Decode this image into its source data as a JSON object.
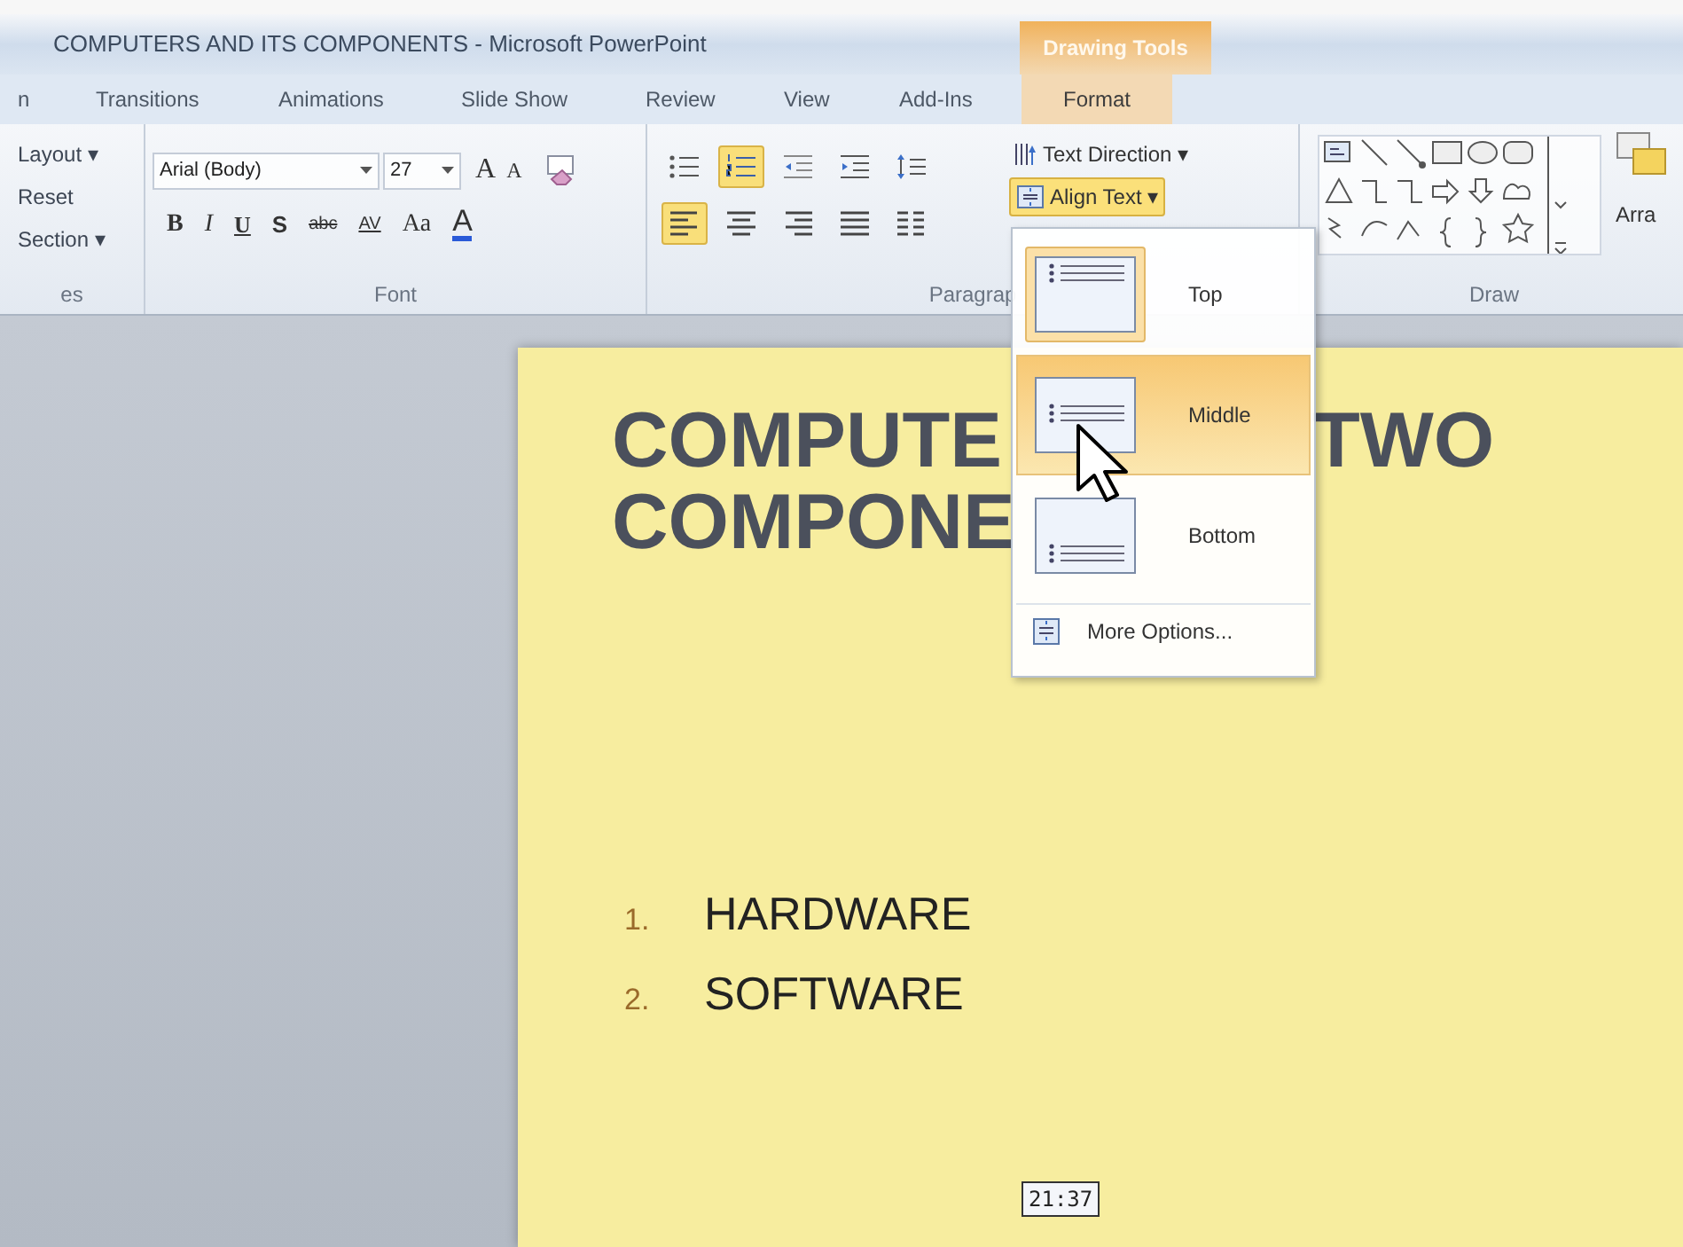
{
  "window": {
    "title": "COMPUTERS AND ITS COMPONENTS - Microsoft PowerPoint",
    "contextual_header": "Drawing Tools"
  },
  "tabs": [
    {
      "label": "n",
      "selected": false
    },
    {
      "label": "Transitions",
      "selected": false
    },
    {
      "label": "Animations",
      "selected": false
    },
    {
      "label": "Slide Show",
      "selected": false
    },
    {
      "label": "Review",
      "selected": false
    },
    {
      "label": "View",
      "selected": false
    },
    {
      "label": "Add-Ins",
      "selected": false
    },
    {
      "label": "Format",
      "selected": true
    }
  ],
  "slides_group": {
    "items": [
      "Layout ▾",
      "Reset",
      "Section ▾"
    ],
    "label": "es"
  },
  "font_group": {
    "font_name": "Arial (Body)",
    "font_size": "27",
    "grow": "A",
    "shrink": "A",
    "buttons": [
      {
        "kind": "bold",
        "label": "B"
      },
      {
        "kind": "italic",
        "label": "I"
      },
      {
        "kind": "underline",
        "label": "U"
      },
      {
        "kind": "shadow",
        "label": "S"
      },
      {
        "kind": "strike",
        "label": "abc"
      },
      {
        "kind": "spacing",
        "label": "AV"
      },
      {
        "kind": "case",
        "label": "Aa"
      },
      {
        "kind": "color",
        "label": "A"
      }
    ],
    "label": "Font"
  },
  "paragraph_group": {
    "row_1": [
      {
        "kind": "bullets",
        "selected": false
      },
      {
        "kind": "numbering",
        "selected": true
      },
      {
        "kind": "outdent",
        "selected": false
      },
      {
        "kind": "indent",
        "selected": false
      },
      {
        "kind": "spacing",
        "selected": false
      }
    ],
    "row_2": [
      {
        "kind": "left",
        "selected": true
      },
      {
        "kind": "center",
        "selected": false
      },
      {
        "kind": "right",
        "selected": false
      },
      {
        "kind": "justify",
        "selected": false
      },
      {
        "kind": "columns",
        "selected": false
      }
    ],
    "text_direction": "Text Direction ▾",
    "align_text": {
      "label": "Align Text ▾",
      "selected": true
    },
    "label": "Paragrap"
  },
  "drawing_group": {
    "arrange": "Arra",
    "label": "Draw"
  },
  "align_menu": [
    {
      "label": "Top",
      "checked": true,
      "highlighted": false
    },
    {
      "label": "Middle",
      "checked": false,
      "highlighted": true
    },
    {
      "label": "Bottom",
      "checked": false,
      "highlighted": false
    }
  ],
  "more_options": "More Options...",
  "slide": {
    "title_line_1_left": "COMPUTE",
    "title_line_1_right": "TWO",
    "title_line_2": "COMPONE",
    "list": [
      {
        "number": "1.",
        "text": "HARDWARE"
      },
      {
        "number": "2.",
        "text": "SOFTWARE"
      }
    ]
  },
  "time_tooltip": "21:37"
}
